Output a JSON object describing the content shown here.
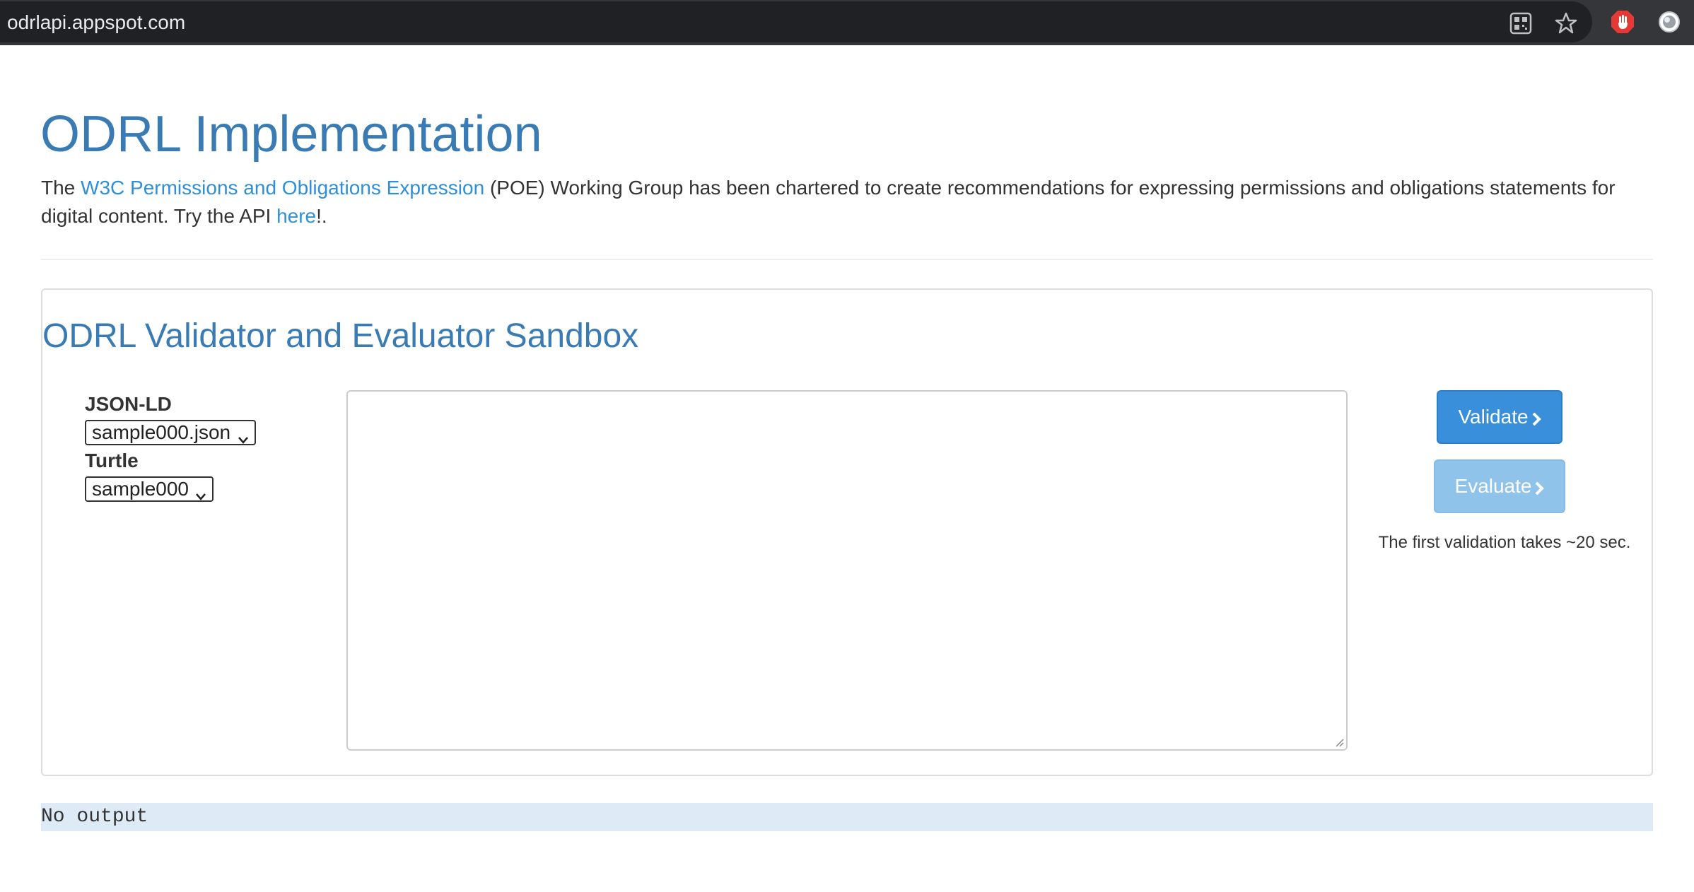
{
  "browser": {
    "url": "odrlapi.appspot.com",
    "icons": [
      "qr-code-icon",
      "bookmark-star-icon",
      "adblock-hand-icon",
      "profile-icon"
    ]
  },
  "header": {
    "title": "ODRL Implementation",
    "intro_prefix": "The ",
    "intro_link": "W3C Permissions and Obligations Expression",
    "intro_middle": " (POE) Working Group has been chartered to create recommendations for expressing permissions and obligations statements for digital content. Try the API ",
    "intro_here_link": "here",
    "intro_suffix": "!."
  },
  "sandbox": {
    "title": "ODRL Validator and Evaluator Sandbox",
    "jsonld_label": "JSON-LD",
    "jsonld_selected": "sample000.json",
    "turtle_label": "Turtle",
    "turtle_selected": "sample000",
    "editor_value": "",
    "validate_label": "Validate",
    "evaluate_label": "Evaluate",
    "note": "The first validation takes ~20 sec."
  },
  "output": {
    "text": "No output"
  },
  "colors": {
    "accent": "#3a7bb4",
    "link": "#2f8fd8",
    "validate_button": "#3a8fda",
    "evaluate_button_disabled": "#8fc3ea",
    "output_bg": "#deeaf6"
  }
}
